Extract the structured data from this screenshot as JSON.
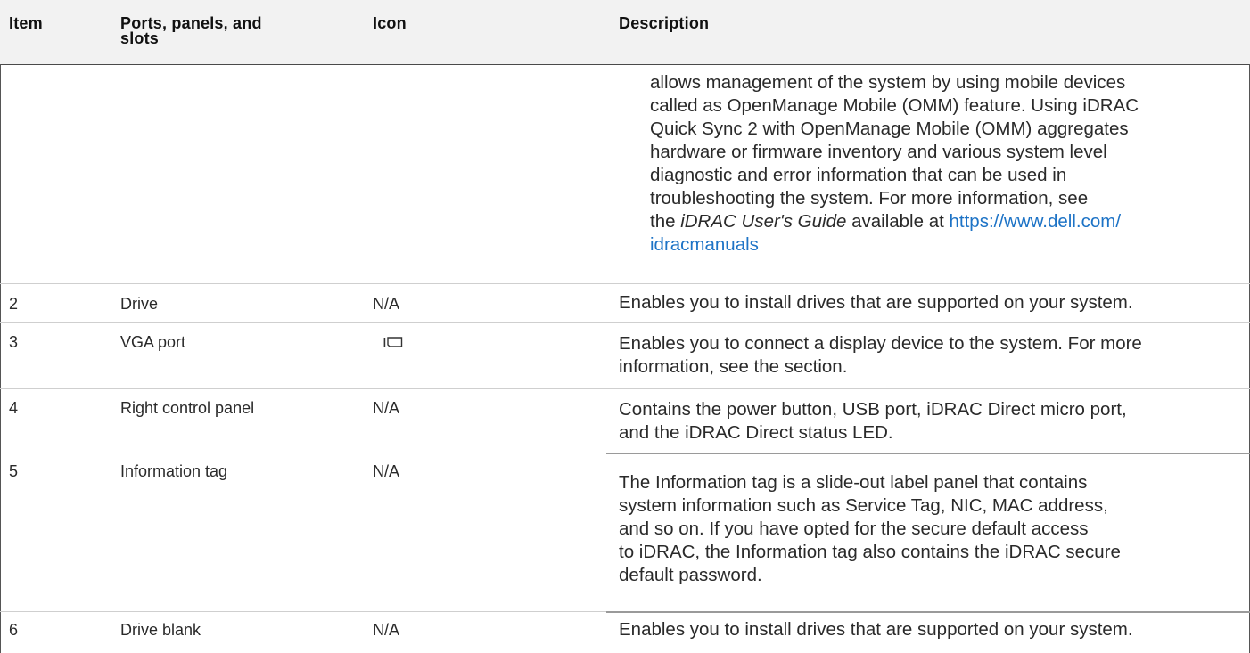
{
  "header": {
    "item": "Item",
    "ports": "Ports, panels, and",
    "ports_line2": "slots",
    "icon": "Icon",
    "description": "Description"
  },
  "continued": {
    "lines": [
      "allows management of the system by using mobile devices",
      "called as OpenManage Mobile (OMM) feature. Using iDRAC",
      "Quick Sync 2 with OpenManage Mobile (OMM) aggregates",
      "hardware or firmware inventory and various system level",
      "diagnostic and error information that can be used in",
      "troubleshooting the system. For more information, see"
    ],
    "last_prefix": "the ",
    "guide": "iDRAC User's Guide",
    "last_middle": " available at ",
    "link_a": "https://www.dell.com/",
    "link_b": "idracmanuals"
  },
  "rows": [
    {
      "item": "2",
      "port": "Drive",
      "icon": "N/A",
      "desc": [
        "Enables you to install drives that are supported on your system."
      ]
    },
    {
      "item": "3",
      "port": "VGA port",
      "icon": "",
      "icon_name": "vga-port-icon",
      "desc": [
        "Enables you to connect a display device to the system. For more",
        "information, see the section."
      ]
    },
    {
      "item": "4",
      "port": "Right control panel",
      "icon": "N/A",
      "desc": [
        "Contains the power button, USB port, iDRAC Direct micro port,",
        "and the iDRAC Direct status LED."
      ]
    },
    {
      "item": "5",
      "port": "Information tag",
      "icon": "N/A",
      "desc": [
        "The Information tag is a slide-out label panel that contains",
        "system information such as Service Tag, NIC, MAC address,",
        "and so on. If you have opted for the secure default access",
        "to iDRAC, the Information tag also contains the iDRAC secure",
        "default password."
      ]
    },
    {
      "item": "6",
      "port": "Drive blank",
      "icon": "N/A",
      "desc": [
        "Enables you to install drives that are supported on your system."
      ]
    }
  ]
}
